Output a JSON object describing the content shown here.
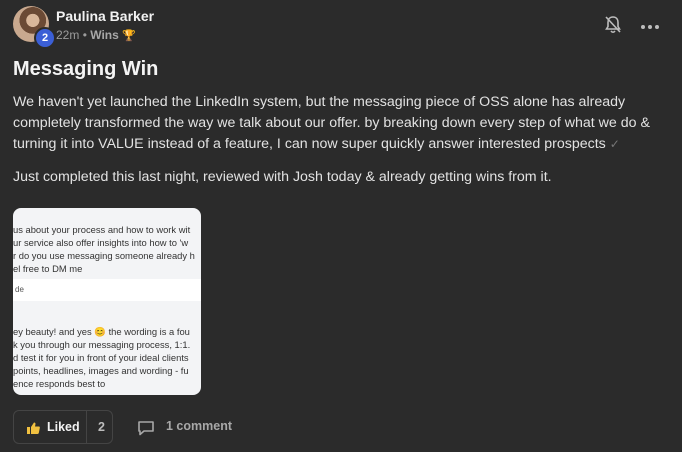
{
  "post": {
    "author": "Paulina Barker",
    "level": "2",
    "time": "22m",
    "separator": "•",
    "category": "Wins",
    "category_icon": "🏆",
    "title": "Messaging Win",
    "paragraph1": "We haven't yet launched the LinkedIn system, but the messaging piece of OSS alone has already completely transformed the way we talk about our offer. by breaking down every step of what we do & turning it into VALUE instead of a feature, I can now super quickly answer interested prospects",
    "paragraph1_icon": "✓",
    "paragraph2": "Just completed this last night, reviewed with Josh today & already getting wins from it."
  },
  "attachment": {
    "lines_top": [
      "us about your process and how to work wit",
      "ur service also offer insights into how to 'w",
      "r do you use messaging someone already h",
      "el free to DM me"
    ],
    "input_text": "de",
    "lines_bottom": [
      "ey beauty! and yes 😊 the wording is a fou",
      "k you through our messaging process, 1:1.",
      "d test it for you in front of your ideal clients",
      " points, headlines, images and wording - fu",
      "ence responds best to"
    ]
  },
  "actions": {
    "like_label": "Liked",
    "like_count": "2",
    "comment_label": "1 comment"
  },
  "icons": {
    "bell": "bell-off-icon",
    "more": "more-horizontal-icon",
    "like": "thumbs-up-icon",
    "comment": "comment-icon"
  },
  "colors": {
    "background": "#2b2b2b",
    "level_badge": "#3b5fd6",
    "like_icon": "#f0c040"
  }
}
